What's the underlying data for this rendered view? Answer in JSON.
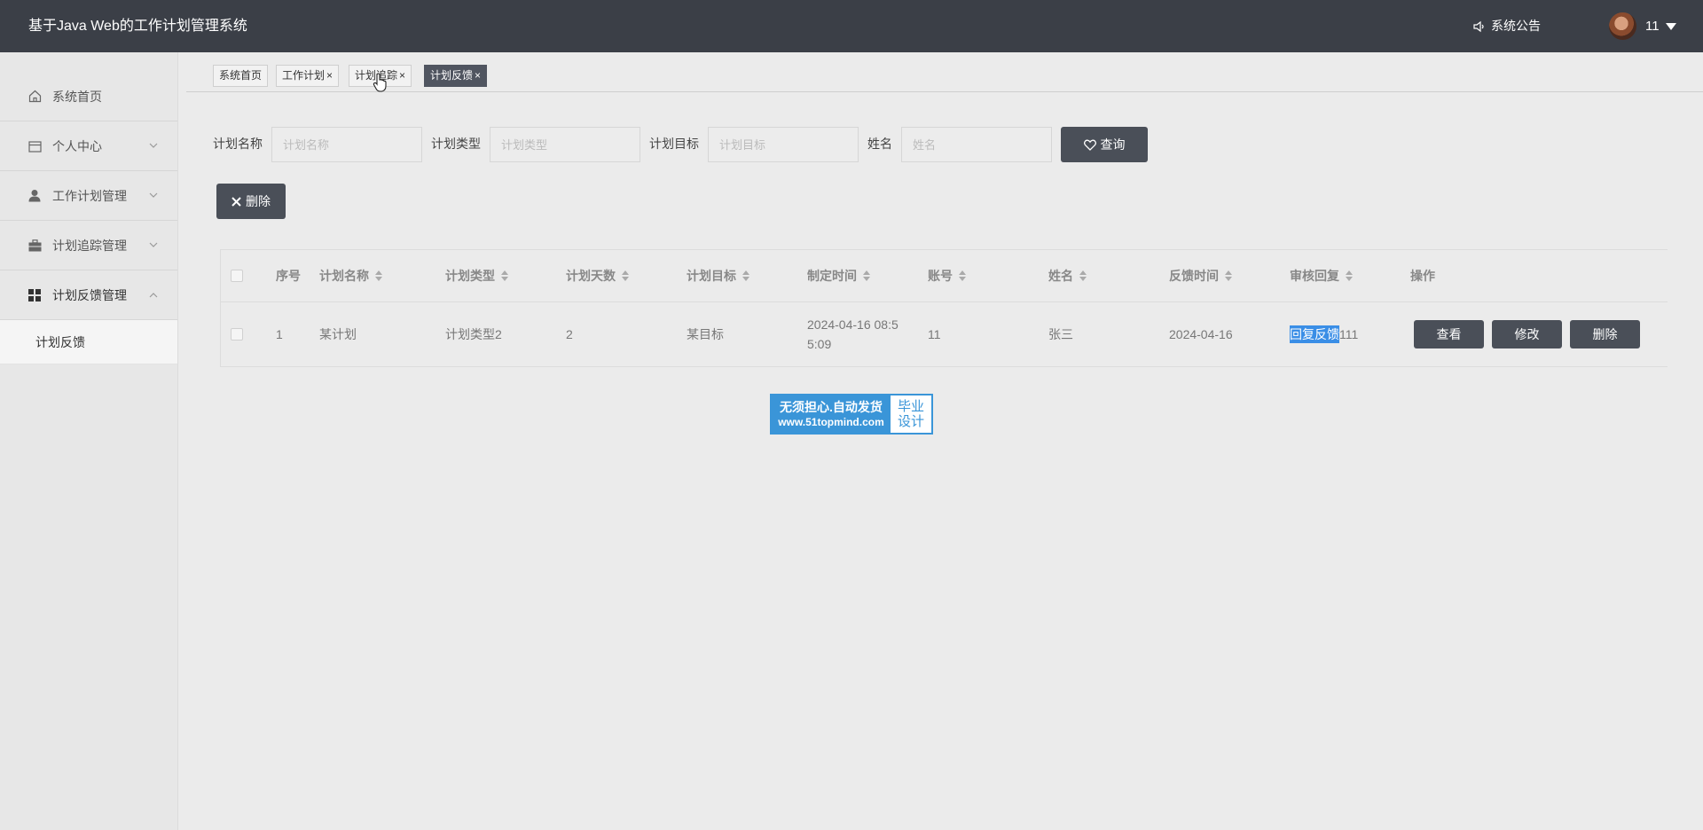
{
  "header": {
    "title": "基于Java Web的工作计划管理系统",
    "notice_label": "系统公告",
    "username": "11"
  },
  "sidebar": {
    "items": [
      {
        "label": "系统首页",
        "icon": "home-icon"
      },
      {
        "label": "个人中心",
        "icon": "calendar-icon"
      },
      {
        "label": "工作计划管理",
        "icon": "user-icon"
      },
      {
        "label": "计划追踪管理",
        "icon": "briefcase-icon"
      },
      {
        "label": "计划反馈管理",
        "icon": "grid-icon"
      }
    ],
    "submenu": {
      "label": "计划反馈"
    }
  },
  "tabs": [
    {
      "label": "系统首页",
      "close": ""
    },
    {
      "label": "工作计划",
      "close": "×"
    },
    {
      "label": "计划追踪",
      "close": "×"
    },
    {
      "label": "计划反馈",
      "close": "×"
    }
  ],
  "search": {
    "fields": [
      {
        "label": "计划名称",
        "placeholder": "计划名称"
      },
      {
        "label": "计划类型",
        "placeholder": "计划类型"
      },
      {
        "label": "计划目标",
        "placeholder": "计划目标"
      },
      {
        "label": "姓名",
        "placeholder": "姓名"
      }
    ],
    "query_label": "查询",
    "delete_label": "删除"
  },
  "table": {
    "columns": [
      "序号",
      "计划名称",
      "计划类型",
      "计划天数",
      "计划目标",
      "制定时间",
      "账号",
      "姓名",
      "反馈时间",
      "审核回复",
      "操作"
    ],
    "rows": [
      {
        "index": "1",
        "name": "某计划",
        "type": "计划类型2",
        "days": "2",
        "goal": "某目标",
        "created_line1": "2024-04-16 08:5",
        "created_line2": "5:09",
        "account": "11",
        "person": "张三",
        "feedback_time": "2024-04-16",
        "reply_highlight": "回复反馈",
        "reply_rest": "111",
        "actions": [
          "查看",
          "修改",
          "删除"
        ]
      }
    ]
  },
  "watermark": {
    "line1": "无须担心.自动发货",
    "line2": "www.51topmind.com",
    "side1": "毕业",
    "side2": "设计"
  },
  "colors": {
    "topbar": "#3b3f47",
    "button": "#4a4f58",
    "highlight": "#3a8ee6",
    "watermark": "#3a95d8"
  }
}
